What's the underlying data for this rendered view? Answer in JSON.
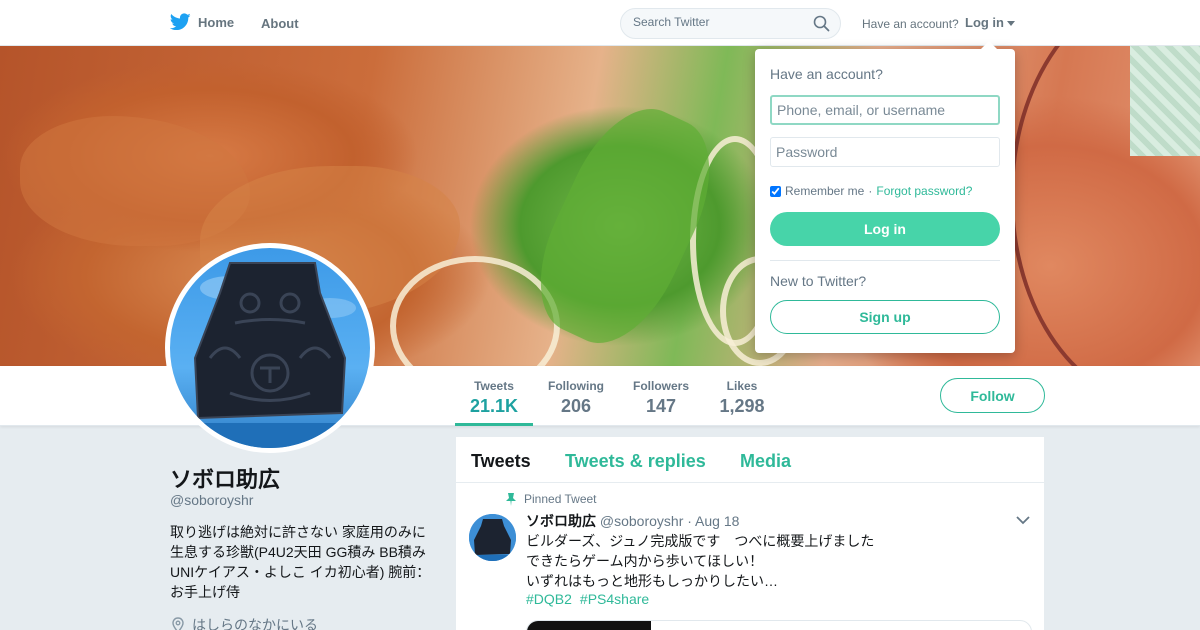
{
  "nav": {
    "home_label": "Home",
    "about_label": "About",
    "search_placeholder": "Search Twitter",
    "have_account": "Have an account?",
    "login_label": "Log in"
  },
  "profile": {
    "name": "ソボロ助広",
    "handle": "@soboroyshr",
    "bio": "取り逃げは絶対に許さない 家庭用のみに生息する珍獣(P4U2天田 GG積み BB積み UNIケイアス・よしこ イカ初心者) 腕前：お手上げ侍",
    "location": "はしらのなかにいる",
    "follow_label": "Follow"
  },
  "stats": [
    {
      "label": "Tweets",
      "value": "21.1K",
      "active": true
    },
    {
      "label": "Following",
      "value": "206",
      "active": false
    },
    {
      "label": "Followers",
      "value": "147",
      "active": false
    },
    {
      "label": "Likes",
      "value": "1,298",
      "active": false
    }
  ],
  "timeline": {
    "tabs": [
      "Tweets",
      "Tweets & replies",
      "Media"
    ],
    "pinned_label": "Pinned Tweet",
    "tweet": {
      "name": "ソボロ助広",
      "handle": "@soboroyshr",
      "date": "· Aug 18",
      "lines": [
        "ビルダーズ、ジュノ完成版です　つべに概要上げました",
        "できたらゲーム内から歩いてほしい！",
        "いずれはもっと地形もしっかりしたい…"
      ],
      "hashtags": [
        "#DQB2",
        "#PS4share"
      ]
    }
  },
  "login_dropdown": {
    "title": "Have an account?",
    "username_placeholder": "Phone, email, or username",
    "password_placeholder": "Password",
    "remember_label": "Remember me",
    "separator": "·",
    "forgot_label": "Forgot password?",
    "login_button": "Log in",
    "new_label": "New to Twitter?",
    "signup_button": "Sign up"
  },
  "colors": {
    "accent": "#2fb999",
    "login_button": "#47d4a9",
    "twitter_blue": "#1da1f2"
  },
  "icons": [
    "twitter-bird-icon",
    "search-icon",
    "pin-icon",
    "location-icon",
    "chevron-down-icon"
  ]
}
